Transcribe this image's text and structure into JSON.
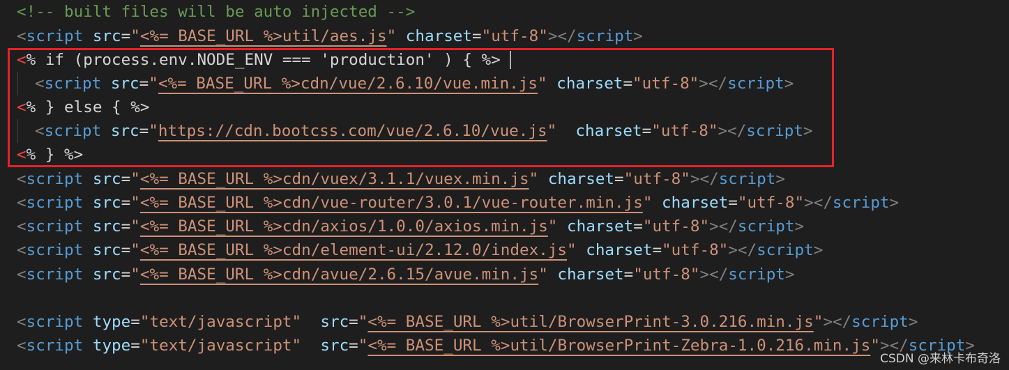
{
  "code": {
    "comment": "<!-- built files will be auto injected -->",
    "base_url": "<%= BASE_URL %>",
    "charset": "utf-8",
    "aes": "util/aes.js",
    "ejs_if": "% if (process.env.NODE_ENV === 'production' ) { %>",
    "vue_local": "cdn/vue/2.6.10/vue.min.js",
    "ejs_else": "% } else { %>",
    "vue_cdn": "https://cdn.bootcss.com/vue/2.6.10/vue.js",
    "ejs_end": "% } %>",
    "vuex": "cdn/vuex/3.1.1/vuex.min.js",
    "router": "cdn/vue-router/3.0.1/vue-router.min.js",
    "axios": "cdn/axios/1.0.0/axios.min.js",
    "element": "cdn/element-ui/2.12.0/index.js",
    "avue": "cdn/avue/2.6.15/avue.min.js",
    "type_js": "text/javascript",
    "print": "util/BrowserPrint-3.0.216.min.js",
    "print_zebra": "util/BrowserPrint-Zebra-1.0.216.min.js"
  },
  "watermark": "CSDN @来林卡布奇洛",
  "colors": {
    "background": "#1e1e1e",
    "tag": "#569cd6",
    "attribute": "#9cdcfe",
    "string": "#ce9178",
    "comment": "#6a9955",
    "highlight_border": "#e3232b"
  }
}
